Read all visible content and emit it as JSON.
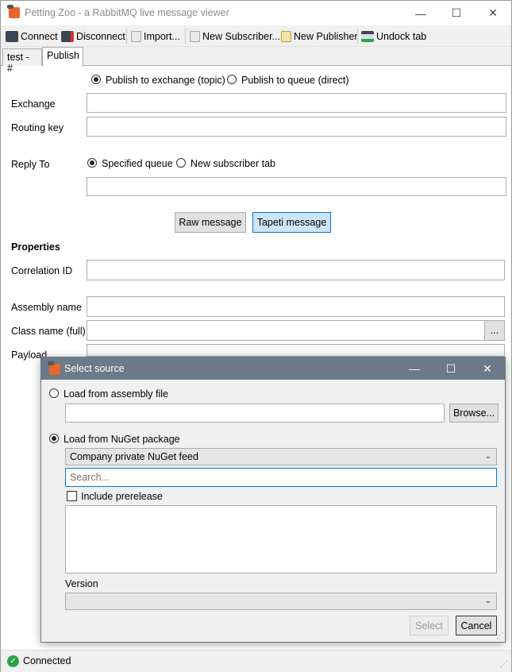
{
  "window": {
    "title": "Petting Zoo - a RabbitMQ live message viewer",
    "minimize": "—",
    "maximize": "☐",
    "close": "✕"
  },
  "toolbar": {
    "connect": "Connect",
    "disconnect": "Disconnect",
    "import": "Import...",
    "new_subscriber": "New Subscriber...",
    "new_publisher": "New Publisher",
    "undock_tab": "Undock tab"
  },
  "tabs": [
    {
      "label": "test - #"
    },
    {
      "label": "Publish"
    }
  ],
  "publish": {
    "mode_exchange": "Publish to exchange (topic)",
    "mode_queue": "Publish to queue (direct)",
    "exchange_label": "Exchange",
    "routing_key_label": "Routing key",
    "reply_to_label": "Reply To",
    "reply_specified": "Specified queue",
    "reply_new_tab": "New subscriber tab",
    "raw_message": "Raw message",
    "tapeti_message": "Tapeti message",
    "properties_heading": "Properties",
    "correlation_label": "Correlation ID",
    "assembly_label": "Assembly name",
    "class_label": "Class name (full)",
    "class_browse": "...",
    "payload_label": "Payload"
  },
  "dialog": {
    "title": "Select source",
    "load_assembly": "Load from assembly file",
    "browse": "Browse...",
    "load_nuget": "Load from NuGet package",
    "feed_selected": "Company private NuGet feed",
    "search_placeholder": "Search...",
    "include_prerelease": "Include prerelease",
    "version_label": "Version",
    "select_button": "Select",
    "cancel_button": "Cancel"
  },
  "status": {
    "text": "Connected"
  },
  "colors": {
    "accent_blue": "#0078d7",
    "dialog_title": "#6c7a89",
    "connected_green": "#2ea24a"
  }
}
